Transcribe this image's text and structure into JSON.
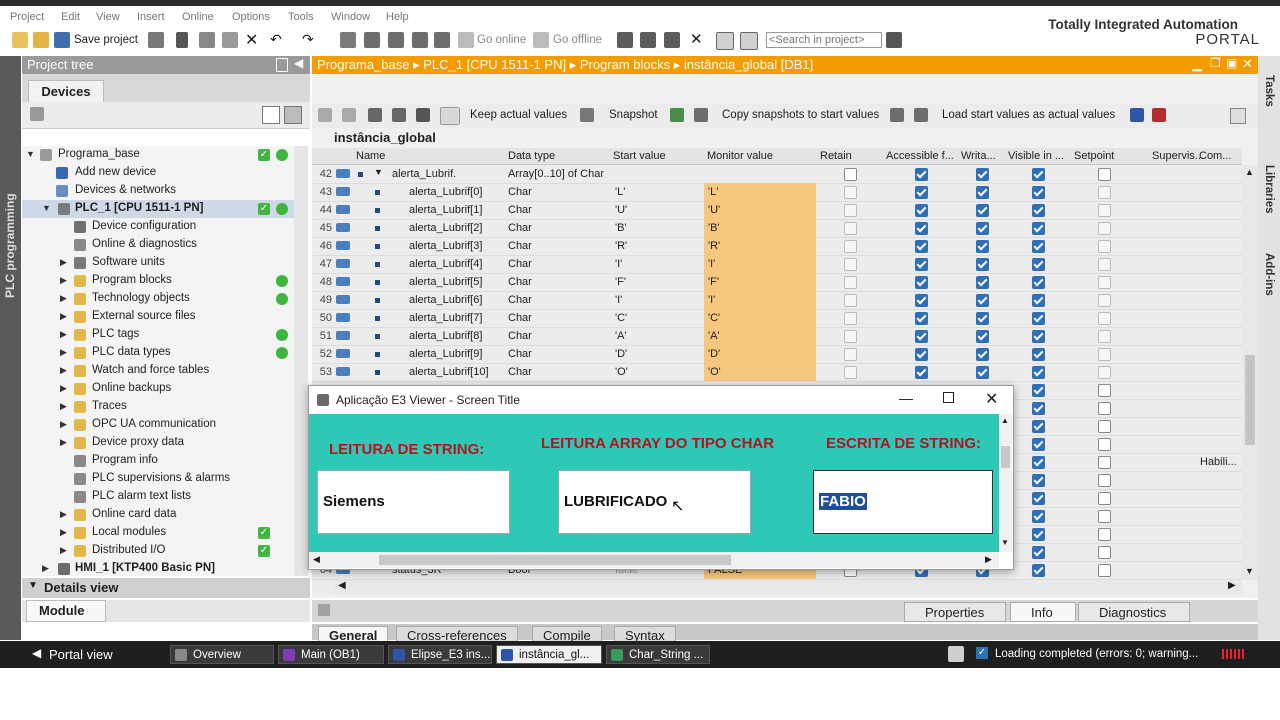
{
  "menu": [
    "Project",
    "Edit",
    "View",
    "Insert",
    "Online",
    "Options",
    "Tools",
    "Window",
    "Help"
  ],
  "toolbar": {
    "save_project": "Save project",
    "go_online": "Go online",
    "go_offline": "Go offline",
    "search_placeholder": "<Search in project>"
  },
  "brand": {
    "line1": "Totally Integrated Automation",
    "line2": "PORTAL"
  },
  "left_strip_label": "PLC programming",
  "project_tree": {
    "title": "Project tree",
    "tab": "Devices",
    "items": [
      {
        "label": "Programa_base",
        "check": true,
        "dot": true
      },
      {
        "label": "Add new device"
      },
      {
        "label": "Devices & networks"
      },
      {
        "label": "PLC_1 [CPU 1511-1 PN]",
        "check": true,
        "dot": true
      },
      {
        "label": "Device configuration"
      },
      {
        "label": "Online & diagnostics"
      },
      {
        "label": "Software units"
      },
      {
        "label": "Program blocks",
        "dot": true
      },
      {
        "label": "Technology objects",
        "dot": true
      },
      {
        "label": "External source files"
      },
      {
        "label": "PLC tags",
        "dot": true
      },
      {
        "label": "PLC data types",
        "dot": true
      },
      {
        "label": "Watch and force tables"
      },
      {
        "label": "Online backups"
      },
      {
        "label": "Traces"
      },
      {
        "label": "OPC UA communication"
      },
      {
        "label": "Device proxy data"
      },
      {
        "label": "Program info"
      },
      {
        "label": "PLC supervisions & alarms"
      },
      {
        "label": "PLC alarm text lists"
      },
      {
        "label": "Online card data"
      },
      {
        "label": "Local modules",
        "check": true
      },
      {
        "label": "Distributed I/O",
        "check": true
      },
      {
        "label": "HMI_1 [KTP400 Basic PN]"
      }
    ],
    "details_view": "Details view",
    "module_tab": "Module"
  },
  "breadcrumb": "Programa_base  ▸  PLC_1 [CPU 1511-1 PN]  ▸  Program blocks  ▸  instância_global [DB1]",
  "db_toolbar": {
    "keep": "Keep actual values",
    "snapshot": "Snapshot",
    "copy": "Copy snapshots to start values",
    "load": "Load start values as actual values"
  },
  "db_title": "instância_global",
  "columns": [
    "Name",
    "Data type",
    "Start value",
    "Monitor value",
    "Retain",
    "Accessible f...",
    "Writa...",
    "Visible in ...",
    "Setpoint",
    "Supervis...",
    "Com..."
  ],
  "rows": [
    {
      "num": "42",
      "name": "alerta_Lubrif.",
      "dtype": "Array[0..10] of Char",
      "start": "",
      "mon": ""
    },
    {
      "num": "43",
      "name": "alerta_Lubrif[0]",
      "dtype": "Char",
      "start": "'L'",
      "mon": "'L'"
    },
    {
      "num": "44",
      "name": "alerta_Lubrif[1]",
      "dtype": "Char",
      "start": "'U'",
      "mon": "'U'"
    },
    {
      "num": "45",
      "name": "alerta_Lubrif[2]",
      "dtype": "Char",
      "start": "'B'",
      "mon": "'B'"
    },
    {
      "num": "46",
      "name": "alerta_Lubrif[3]",
      "dtype": "Char",
      "start": "'R'",
      "mon": "'R'"
    },
    {
      "num": "47",
      "name": "alerta_Lubrif[4]",
      "dtype": "Char",
      "start": "'I'",
      "mon": "'I'"
    },
    {
      "num": "48",
      "name": "alerta_Lubrif[5]",
      "dtype": "Char",
      "start": "'F'",
      "mon": "'F'"
    },
    {
      "num": "49",
      "name": "alerta_Lubrif[6]",
      "dtype": "Char",
      "start": "'I'",
      "mon": "'I'"
    },
    {
      "num": "50",
      "name": "alerta_Lubrif[7]",
      "dtype": "Char",
      "start": "'C'",
      "mon": "'C'"
    },
    {
      "num": "51",
      "name": "alerta_Lubrif[8]",
      "dtype": "Char",
      "start": "'A'",
      "mon": "'A'"
    },
    {
      "num": "52",
      "name": "alerta_Lubrif[9]",
      "dtype": "Char",
      "start": "'D'",
      "mon": "'D'"
    },
    {
      "num": "53",
      "name": "alerta_Lubrif[10]",
      "dtype": "Char",
      "start": "'O'",
      "mon": "'O'"
    }
  ],
  "hidden_row": {
    "num": "64",
    "name": "status_3R",
    "dtype": "Bool",
    "start": "false",
    "mon": "FALSE"
  },
  "comment_cell": "Habili...",
  "bottom_tabs": [
    "Properties",
    "Info",
    "Diagnostics"
  ],
  "sub_tabs": [
    "General",
    "Cross-references",
    "Compile",
    "Syntax"
  ],
  "right_tabs": [
    "Tasks",
    "Libraries",
    "Add-ins"
  ],
  "taskbar": {
    "portal_view": "Portal view",
    "items": [
      "Overview",
      "Main (OB1)",
      "Elipse_E3 ins...",
      "instância_gl...",
      "Char_String ..."
    ],
    "status": "Loading completed (errors: 0; warning..."
  },
  "dialog": {
    "title": "Aplicação E3 Viewer - Screen Title",
    "label1": "LEITURA DE STRING:",
    "label2": "LEITURA ARRAY DO TIPO CHAR",
    "label3": "ESCRITA DE STRING:",
    "value1": "Siemens",
    "value2": "LUBRIFICADO",
    "value3": "FABIO"
  }
}
